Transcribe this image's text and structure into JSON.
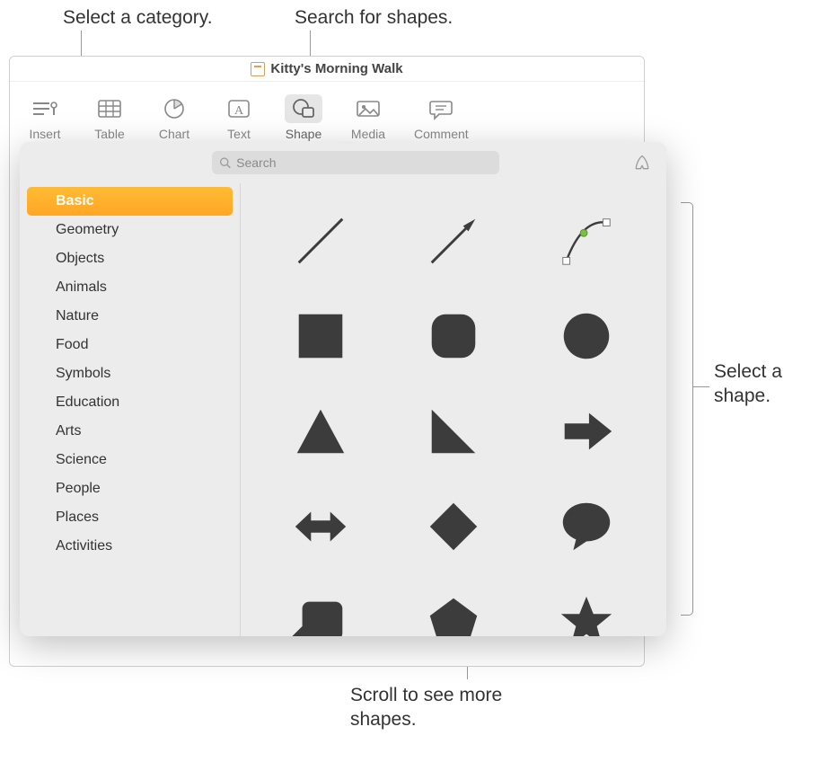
{
  "callouts": {
    "category": "Select a category.",
    "search": "Search for shapes.",
    "shape": "Select a shape.",
    "scroll": "Scroll to see more shapes."
  },
  "window": {
    "title": "Kitty's Morning Walk"
  },
  "toolbar": {
    "insert": "Insert",
    "table": "Table",
    "chart": "Chart",
    "text": "Text",
    "shape": "Shape",
    "media": "Media",
    "comment": "Comment"
  },
  "popover": {
    "search_placeholder": "Search",
    "categories": [
      "Basic",
      "Geometry",
      "Objects",
      "Animals",
      "Nature",
      "Food",
      "Symbols",
      "Education",
      "Arts",
      "Science",
      "People",
      "Places",
      "Activities"
    ],
    "selected_index": 0,
    "shapes": [
      "line",
      "arrow-line",
      "curve",
      "square",
      "rounded-square",
      "circle",
      "triangle",
      "right-triangle",
      "arrow-right",
      "arrow-bidir",
      "diamond",
      "speech-bubble",
      "callout-box",
      "pentagon",
      "star"
    ]
  }
}
